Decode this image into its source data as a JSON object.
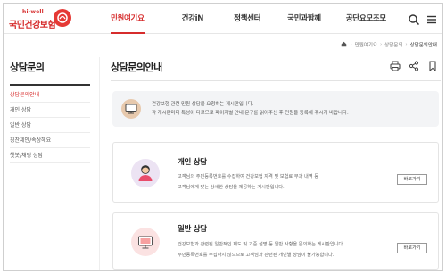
{
  "header": {
    "logo_small": "hi-well",
    "logo_name": "국민건강보험",
    "brand_color": "#d62c2c",
    "nav": [
      {
        "label": "민원여기요",
        "active": true
      },
      {
        "label": "건강iN",
        "active": false
      },
      {
        "label": "정책센터",
        "active": false
      },
      {
        "label": "국민과함께",
        "active": false
      },
      {
        "label": "공단요모조모",
        "active": false
      }
    ],
    "icons": [
      "search-icon",
      "menu-icon"
    ]
  },
  "breadcrumb": {
    "items": [
      "민원여기요",
      "상담문의",
      "상담문의안내"
    ],
    "home_icon": "home-icon"
  },
  "sidebar": {
    "title": "상담문의",
    "items": [
      {
        "label": "상담문의안내",
        "active": true
      },
      {
        "label": "개인 상담",
        "active": false
      },
      {
        "label": "일반 상담",
        "active": false
      },
      {
        "label": "칭찬제안/속상해요",
        "active": false
      },
      {
        "label": "챗봇/채팅 상담",
        "active": false
      }
    ]
  },
  "main": {
    "title": "상담문의안내",
    "tools": [
      "print-icon",
      "share-icon",
      "bookmark-icon"
    ],
    "notice": {
      "line1": "건강보험 관련 민원 상담을 요청하는 게시판입니다.",
      "line2": "각 게시판마다 특성이 다르므로 페이지별 안내 문구를 읽어주신 후 민원을 등록해 주시기 바랍니다."
    },
    "cards": [
      {
        "title": "개인 상담",
        "desc1": "고객님의 주민등록번호를 수집하여 건강보험 자격 및 보험료 부과 내역 등",
        "desc2": "고객님에게 맞는 상세한 상담을 제공하는 게시판입니다.",
        "button": "바로가기",
        "icon": "person-icon",
        "circle_color": "#ece3f3"
      },
      {
        "title": "일반 상담",
        "desc1": "건강보험과 관련된 일반적인 제도 및 기준 설명 등 일반 사항을 문의하는 게시판입니다.",
        "desc2": "주민등록번호를 수집하지 않으므로 고객님과 관련된 개인별 상담이 불가능합니다.",
        "button": "바로가기",
        "icon": "monitor-icon",
        "circle_color": "#fbe2e2"
      }
    ]
  }
}
